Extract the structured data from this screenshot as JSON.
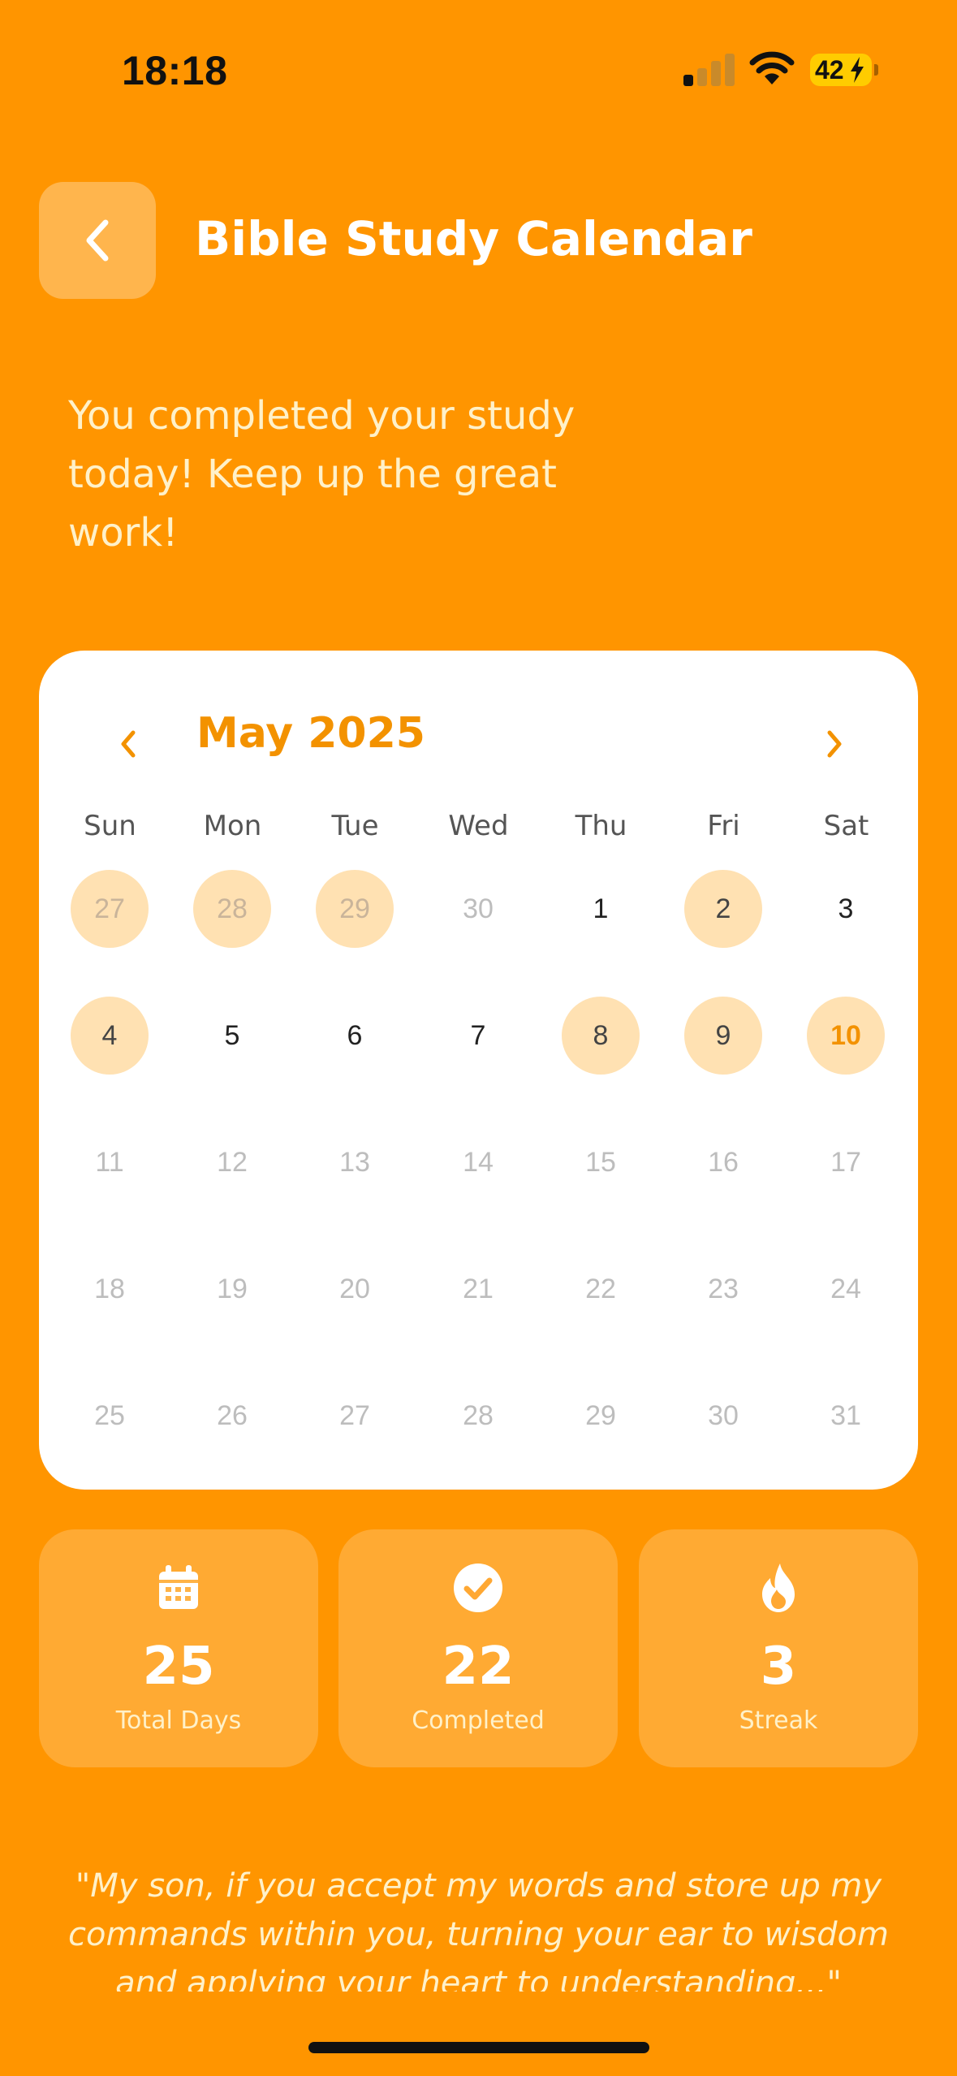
{
  "status_bar": {
    "time": "18:18",
    "battery": "42"
  },
  "header": {
    "title": "Bible Study Calendar"
  },
  "message": "You completed your study today! Keep up the great work!",
  "calendar": {
    "month_label": "May 2025",
    "weekdays": [
      "Sun",
      "Mon",
      "Tue",
      "Wed",
      "Thu",
      "Fri",
      "Sat"
    ],
    "weeks": [
      [
        {
          "label": "27",
          "state": "done-outside"
        },
        {
          "label": "28",
          "state": "done-outside"
        },
        {
          "label": "29",
          "state": "done-outside"
        },
        {
          "label": "30",
          "state": "outside"
        },
        {
          "label": "1",
          "state": "normal"
        },
        {
          "label": "2",
          "state": "done"
        },
        {
          "label": "3",
          "state": "normal"
        }
      ],
      [
        {
          "label": "4",
          "state": "done"
        },
        {
          "label": "5",
          "state": "normal"
        },
        {
          "label": "6",
          "state": "normal"
        },
        {
          "label": "7",
          "state": "normal"
        },
        {
          "label": "8",
          "state": "done"
        },
        {
          "label": "9",
          "state": "done"
        },
        {
          "label": "10",
          "state": "today"
        }
      ],
      [
        {
          "label": "11",
          "state": "future"
        },
        {
          "label": "12",
          "state": "future"
        },
        {
          "label": "13",
          "state": "future"
        },
        {
          "label": "14",
          "state": "future"
        },
        {
          "label": "15",
          "state": "future"
        },
        {
          "label": "16",
          "state": "future"
        },
        {
          "label": "17",
          "state": "future"
        }
      ],
      [
        {
          "label": "18",
          "state": "future"
        },
        {
          "label": "19",
          "state": "future"
        },
        {
          "label": "20",
          "state": "future"
        },
        {
          "label": "21",
          "state": "future"
        },
        {
          "label": "22",
          "state": "future"
        },
        {
          "label": "23",
          "state": "future"
        },
        {
          "label": "24",
          "state": "future"
        }
      ],
      [
        {
          "label": "25",
          "state": "future"
        },
        {
          "label": "26",
          "state": "future"
        },
        {
          "label": "27",
          "state": "future"
        },
        {
          "label": "28",
          "state": "future"
        },
        {
          "label": "29",
          "state": "future"
        },
        {
          "label": "30",
          "state": "future"
        },
        {
          "label": "31",
          "state": "future"
        }
      ]
    ]
  },
  "stats": [
    {
      "icon": "calendar-icon",
      "value": "25",
      "label": "Total Days"
    },
    {
      "icon": "checkmark-circle-icon",
      "value": "22",
      "label": "Completed"
    },
    {
      "icon": "flame-icon",
      "value": "3",
      "label": "Streak"
    }
  ],
  "verse": "\"My son, if you accept my words and store up my commands within you, turning your ear to wisdom and applying your heart to understanding...\"",
  "colors": {
    "background": "#FF9500",
    "accent": "#F39200",
    "completed_day": "#FFE1B2",
    "card": "#FFFFFF"
  }
}
